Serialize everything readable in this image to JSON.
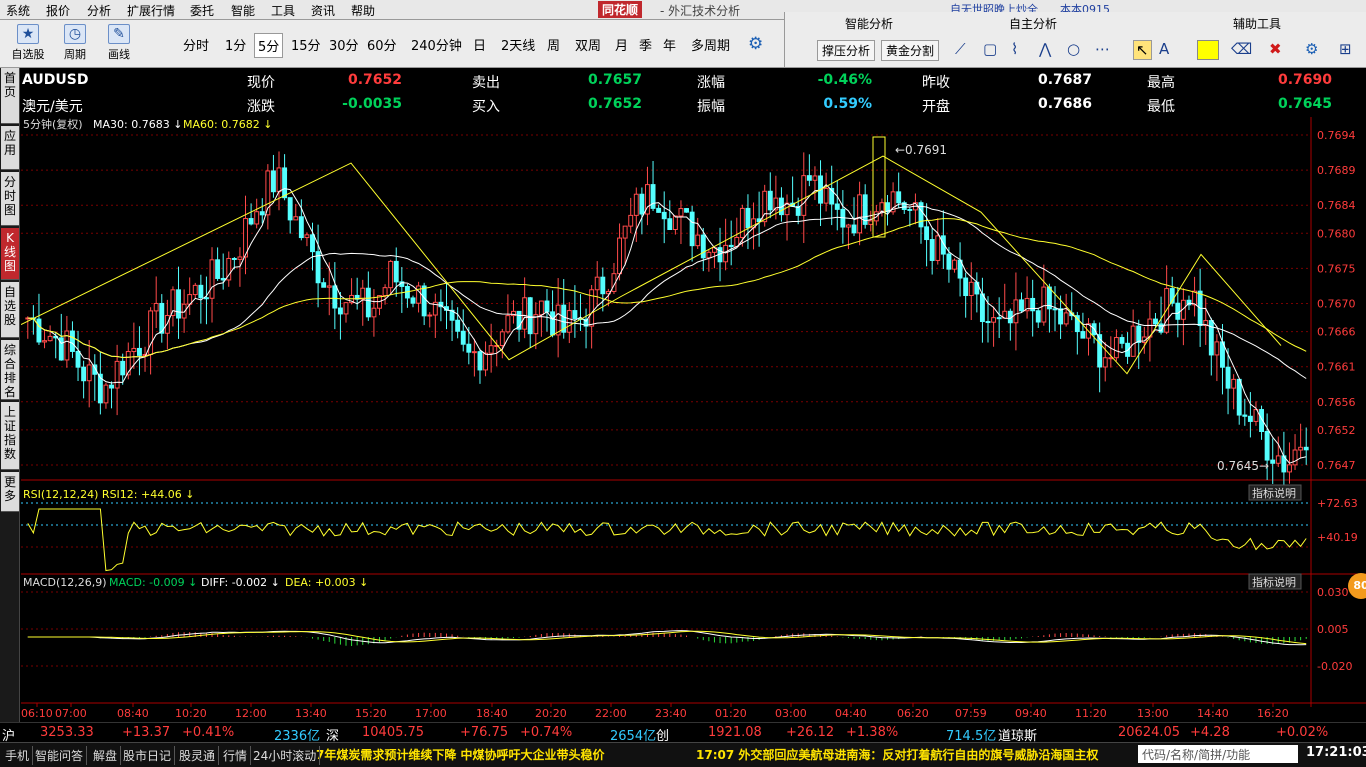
{
  "menu": [
    "系统",
    "报价",
    "分析",
    "扩展行情",
    "委托",
    "智能",
    "工具",
    "资讯",
    "帮助"
  ],
  "brand": "同花顺",
  "app_title": " - 外汇技术分析",
  "top_news": "自无世昭晚上炒全　　本本0915",
  "toolbar": {
    "big": [
      {
        "label": "自选股",
        "icon": "star-icon"
      },
      {
        "label": "周期",
        "icon": "clock-icon"
      },
      {
        "label": "画线",
        "icon": "pen-icon"
      }
    ],
    "periods": [
      "分时",
      "1分",
      "5分",
      "15分",
      "30分",
      "60分",
      "240分钟",
      "日",
      "2天线",
      "周",
      "双周",
      "月",
      "季",
      "年",
      "多周期"
    ],
    "active_period": "5分"
  },
  "right_tools": {
    "headers": [
      "智能分析",
      "自主分析",
      "辅助工具"
    ],
    "buttons": [
      "撑压分析",
      "黄金分割"
    ],
    "top_tabs": [
      "资讯",
      "委托"
    ]
  },
  "left_nav": [
    "首页",
    "应用",
    "分时图",
    "K线图",
    "自选股",
    "综合排名",
    "上证指数",
    "更多"
  ],
  "quote": {
    "symbol": "AUDUSD",
    "name": "澳元/美元",
    "row1": [
      [
        "现价",
        "0.7652",
        "red"
      ],
      [
        "卖出",
        "0.7657",
        "green"
      ],
      [
        "涨幅",
        "-0.46%",
        "green"
      ],
      [
        "昨收",
        "0.7687",
        "white"
      ],
      [
        "最高",
        "0.7690",
        "red"
      ]
    ],
    "row2": [
      [
        "涨跌",
        "-0.0035",
        "green"
      ],
      [
        "买入",
        "0.7652",
        "green"
      ],
      [
        "振幅",
        "0.59%",
        "cyan"
      ],
      [
        "开盘",
        "0.7686",
        "white"
      ],
      [
        "最低",
        "0.7645",
        "green"
      ]
    ]
  },
  "main_header": {
    "period": "5分钟(复权)",
    "ma30": "MA30: 0.7683",
    "ma60": "MA60: 0.7682"
  },
  "rsi_header": {
    "name": "RSI(12,12,24)",
    "value": "RSI12: +44.06"
  },
  "macd_header": {
    "name": "MACD(12,26,9)",
    "macd": "MACD: -0.009",
    "diff": "DIFF: -0.002",
    "dea": "DEA: +0.003"
  },
  "indicator_button": "指标说明",
  "chart_data": {
    "type": "candlestick",
    "price_ticks": [
      "0.7694",
      "0.7689",
      "0.7684",
      "0.7680",
      "0.7675",
      "0.7670",
      "0.7666",
      "0.7661",
      "0.7656",
      "0.7652",
      "0.7647"
    ],
    "rsi_ticks": [
      "+72.63",
      "+40.19"
    ],
    "macd_ticks": [
      "0.030",
      "0.005",
      "-0.020"
    ],
    "high_label": "0.7691",
    "low_label": "0.7645",
    "x_ticks": [
      "06:10",
      "07:00",
      "08:40",
      "10:20",
      "12:00",
      "13:40",
      "15:20",
      "17:00",
      "18:40",
      "20:20",
      "22:00",
      "23:40",
      "01:20",
      "03:00",
      "04:40",
      "06:20",
      "07:59",
      "09:40",
      "11:20",
      "13:00",
      "14:40",
      "16:20"
    ],
    "close_path": [
      0.7668,
      0.7666,
      0.7664,
      0.766,
      0.7658,
      0.7662,
      0.7665,
      0.7668,
      0.767,
      0.7672,
      0.7674,
      0.7678,
      0.7684,
      0.7688,
      0.7682,
      0.7676,
      0.7672,
      0.767,
      0.7669,
      0.7674,
      0.7672,
      0.767,
      0.7666,
      0.7662,
      0.7664,
      0.7667,
      0.7668,
      0.767,
      0.7666,
      0.7668,
      0.7672,
      0.7678,
      0.7684,
      0.7686,
      0.7682,
      0.768,
      0.7678,
      0.768,
      0.7684,
      0.7686,
      0.7684,
      0.7688,
      0.7683,
      0.7682,
      0.7684,
      0.7686,
      0.7684,
      0.768,
      0.7676,
      0.7672,
      0.7668,
      0.7666,
      0.7668,
      0.767,
      0.7668,
      0.7666,
      0.7664,
      0.7662,
      0.7666,
      0.7668,
      0.767,
      0.7672,
      0.7664,
      0.7658,
      0.7654,
      0.765,
      0.7647,
      0.7652
    ]
  },
  "status": {
    "items": [
      [
        "沪",
        "white"
      ],
      [
        "3253.33",
        "red"
      ],
      [
        "+13.37",
        "red"
      ],
      [
        "+0.41%",
        "red"
      ],
      [
        "2336亿",
        "cyan"
      ],
      [
        "深",
        "white"
      ],
      [
        "10405.75",
        "red"
      ],
      [
        "+76.75",
        "red"
      ],
      [
        "+0.74%",
        "red"
      ],
      [
        "2654亿",
        "cyan"
      ],
      [
        "创",
        "white"
      ],
      [
        "1921.08",
        "red"
      ],
      [
        "+26.12",
        "red"
      ],
      [
        "+1.38%",
        "red"
      ],
      [
        "714.5亿",
        "cyan"
      ],
      [
        "道琼斯",
        "white"
      ],
      [
        "20624.05",
        "red"
      ],
      [
        "+4.28",
        "red"
      ],
      [
        "+0.02%",
        "red"
      ]
    ]
  },
  "bottom": {
    "buttons": [
      "手机",
      "智能问答",
      "解盘",
      "股市日记",
      "股灵通",
      "行情",
      "24小时滚动"
    ],
    "ticker1": "7年煤炭需求预计维续下降 中煤协呼吁大企业带头稳价",
    "ticker2": "17:07 外交部回应美航母进南海：反对打着航行自由的旗号威胁沿海国主权",
    "search_placeholder": "代码/名称/简拼/功能",
    "clock": "17:21:03",
    "badge": "80"
  }
}
